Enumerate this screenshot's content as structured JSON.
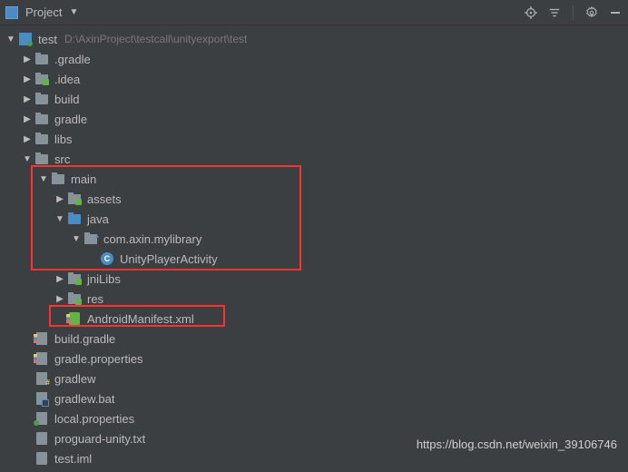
{
  "header": {
    "title": "Project"
  },
  "root": {
    "name": "test",
    "path": "D:\\AxinProject\\testcall\\unityexport\\test"
  },
  "tree": {
    "gradle_dir": ".gradle",
    "idea_dir": ".idea",
    "build_dir": "build",
    "gradle_dir2": "gradle",
    "libs_dir": "libs",
    "src_dir": "src",
    "main_dir": "main",
    "assets_dir": "assets",
    "java_dir": "java",
    "package_name": "com.axin.mylibrary",
    "class_name": "UnityPlayerActivity",
    "jniLibs_dir": "jniLibs",
    "res_dir": "res",
    "manifest_file": "AndroidManifest.xml",
    "build_gradle": "build.gradle",
    "gradle_props": "gradle.properties",
    "gradlew": "gradlew",
    "gradlew_bat": "gradlew.bat",
    "local_props": "local.properties",
    "proguard": "proguard-unity.txt",
    "test_iml": "test.iml"
  },
  "watermark": "https://blog.csdn.net/weixin_39106746"
}
